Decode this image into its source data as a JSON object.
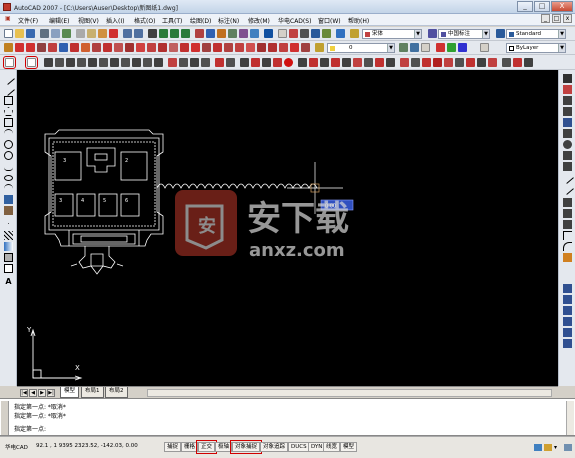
{
  "window": {
    "title": "AutoCAD 2007 - [C:\\Users\\Auser\\Desktop\\新图纸1.dwg]",
    "controls": [
      "_",
      "□",
      "X"
    ]
  },
  "menu": {
    "items": [
      "文件(F)",
      "编辑(E)",
      "视图(V)",
      "插入(I)",
      "格式(O)",
      "工具(T)",
      "绘图(D)",
      "标注(N)",
      "修改(M)",
      "华电CAD(S)",
      "窗口(W)",
      "帮助(H)"
    ],
    "doc_controls": [
      "_",
      "□",
      "x"
    ]
  },
  "toolbar": {
    "text_style": "宋体",
    "dim_style": "中国标注",
    "table_style": "Standard",
    "layer": "0",
    "color": "ByLayer",
    "linetype": "ByLayer",
    "lineweight": "ByLayer",
    "plot_style": "ByColor"
  },
  "drawing": {
    "labels": [
      "3",
      "2",
      "3",
      "4",
      "5",
      "6"
    ],
    "ucs_x": "X",
    "ucs_y": "Y",
    "cursor_tip": "0.00"
  },
  "watermark": {
    "brand": "安下载",
    "domain": "anxz.com"
  },
  "tabs": {
    "nav": [
      "|◀",
      "◀",
      "▶",
      "▶|"
    ],
    "items": [
      "模型",
      "布局1",
      "布局2"
    ]
  },
  "command": {
    "lines": [
      "指定第一点: *取消*",
      "指定第一点: *取消*",
      "指定第一点:"
    ]
  },
  "status": {
    "brand": "华电CAD",
    "coords": "92.1 , 1 9395 2323.52, -142.03, 0.00",
    "buttons": [
      "捕捉",
      "栅格",
      "正交",
      "极轴",
      "对象捕捉",
      "对象追踪",
      "DUCS",
      "DYN",
      "线宽",
      "模型"
    ]
  }
}
